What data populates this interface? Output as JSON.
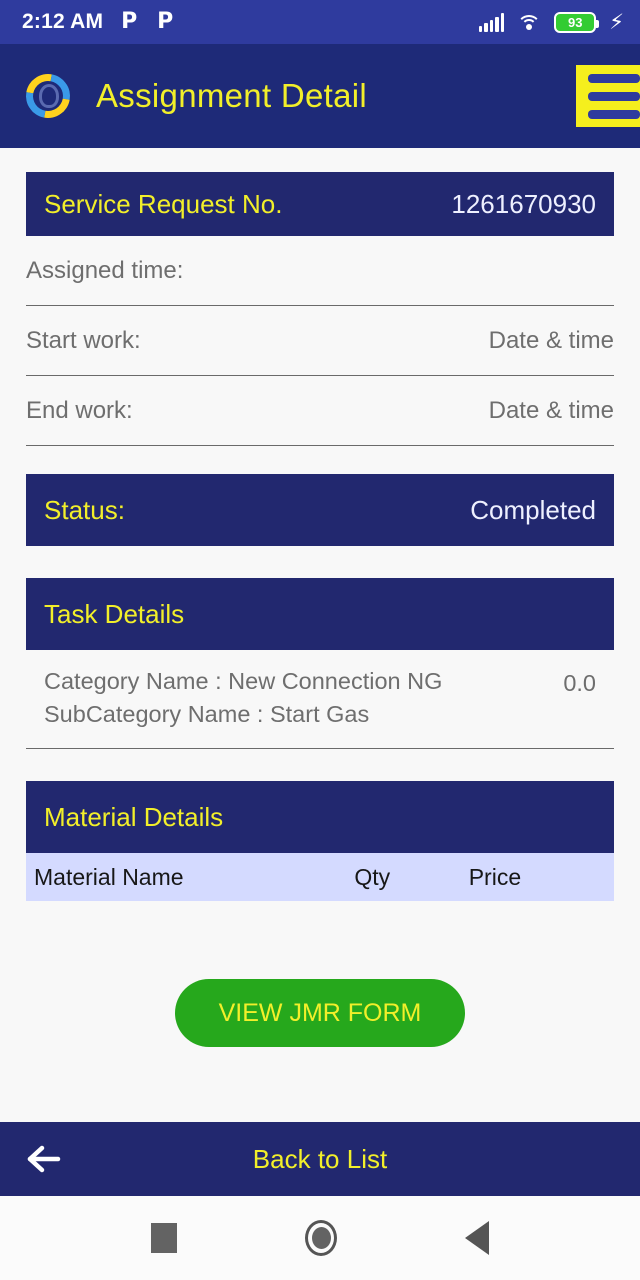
{
  "status_bar": {
    "time": "2:12 AM",
    "notification_icons": [
      "P",
      "P"
    ],
    "signal_icon": "signal-bars-icon",
    "wifi_icon": "wifi-icon",
    "battery_level": "93",
    "charging_icon": "⚡",
    "battery_color": "#33cc33",
    "background": "#2f3b9e"
  },
  "appbar": {
    "logo_name": "app-logo",
    "title": "Assignment Detail",
    "menu_icon": "hamburger-menu-icon",
    "title_color": "#f2ef2a",
    "background": "#1e2a78",
    "menu_background": "#f5ef1d"
  },
  "service_request": {
    "label": "Service Request No.",
    "value": "1261670930"
  },
  "info_rows": [
    {
      "label": "Assigned time:",
      "value": ""
    },
    {
      "label": "Start work:",
      "value": "Date & time"
    },
    {
      "label": "End work:",
      "value": "Date & time"
    }
  ],
  "status": {
    "label": "Status:",
    "value": "Completed"
  },
  "task_details": {
    "title": "Task Details",
    "category_line": "Category Name : New Connection NG",
    "subcategory_line": "SubCategory Name : Start Gas",
    "amount": "0.0"
  },
  "material_details": {
    "title": "Material Details",
    "columns": [
      "Material Name",
      "Qty",
      "Price"
    ],
    "rows": []
  },
  "actions": {
    "jmr_button": "VIEW JMR FORM",
    "jmr_color": "#26a81c",
    "back_label": "Back to List",
    "back_icon": "arrow-left-icon"
  },
  "android_nav": {
    "recents_icon": "square-recents-icon",
    "home_icon": "circle-home-icon",
    "back_icon": "triangle-back-icon"
  }
}
